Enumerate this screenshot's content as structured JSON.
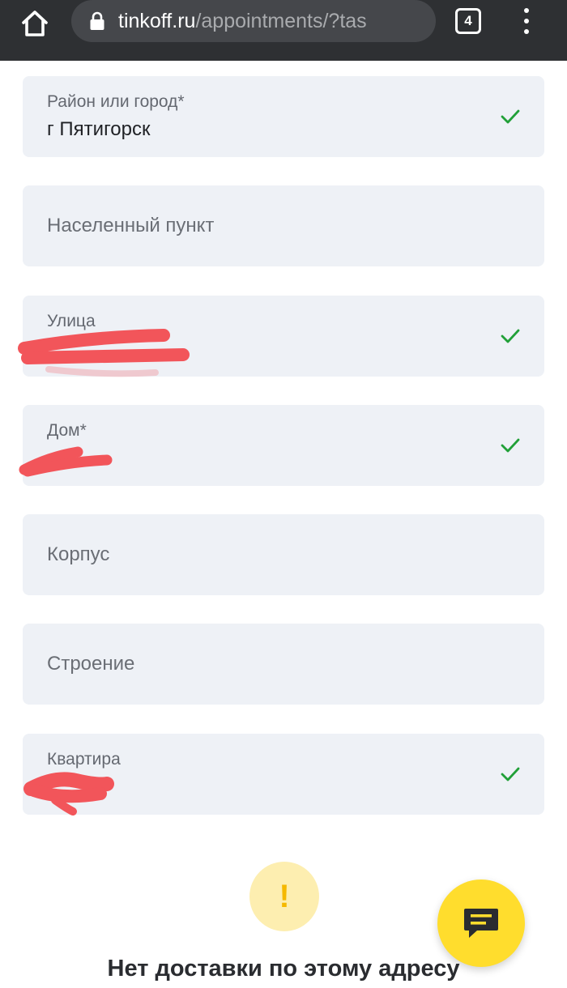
{
  "browser": {
    "url_host": "tinkoff.ru",
    "url_path": "/appointments/?tas",
    "tab_count": "4",
    "icons": {
      "home": "home-icon",
      "lock": "lock-icon",
      "menu": "more-vert-icon"
    }
  },
  "form": {
    "fields": [
      {
        "label": "Район или город*",
        "value": "г Пятигорск",
        "filled": true,
        "valid": true
      },
      {
        "label": "Населенный пункт",
        "value": "",
        "filled": false,
        "valid": false
      },
      {
        "label": "Улица",
        "value": "",
        "filled": true,
        "valid": true,
        "value_redacted": true
      },
      {
        "label": "Дом*",
        "value": "",
        "filled": true,
        "valid": true,
        "value_redacted": true
      },
      {
        "label": "Корпус",
        "value": "",
        "filled": false,
        "valid": false
      },
      {
        "label": "Строение",
        "value": "",
        "filled": false,
        "valid": false
      },
      {
        "label": "Квартира",
        "value": "",
        "filled": true,
        "valid": true,
        "value_redacted": true
      }
    ]
  },
  "status": {
    "icon": "exclamation-icon",
    "glyph": "!",
    "title": "Нет доставки по этому адресу"
  },
  "chat": {
    "icon": "chat-icon"
  },
  "colors": {
    "browser_bar": "#2e3033",
    "field_bg": "#eef1f6",
    "check": "#21a038",
    "redaction": "#f2555a",
    "warning": "#f5b800",
    "warning_bg": "#fdeeb0",
    "accent_yellow": "#ffdd2d"
  }
}
